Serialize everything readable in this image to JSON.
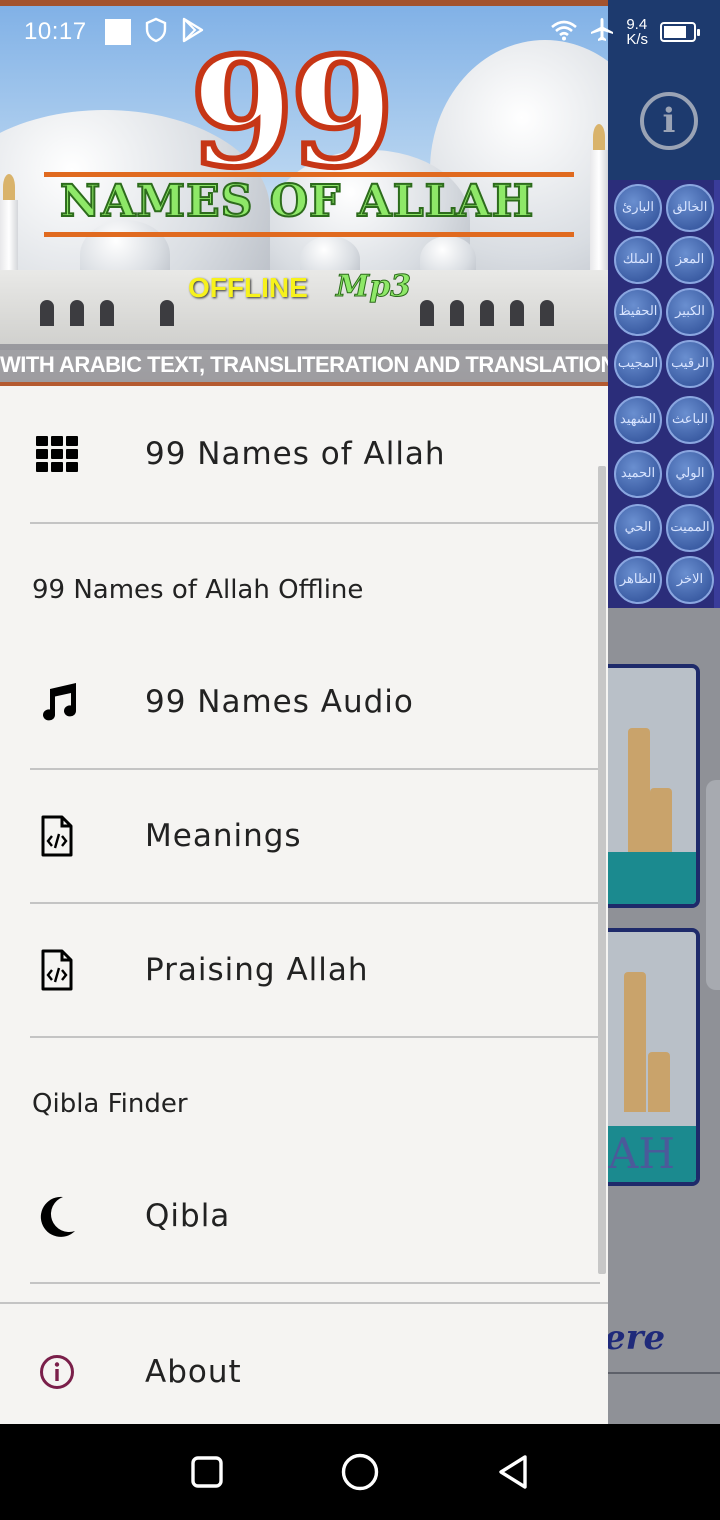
{
  "status_bar": {
    "time": "10:17",
    "net_speed_value": "9.4",
    "net_speed_unit": "K/s"
  },
  "banner": {
    "number": "99",
    "title": "NAMES OF ALLAH",
    "offline": "OFFLINE",
    "mp3": "Mp3",
    "subtitle": "WITH ARABIC TEXT, TRANSLITERATION AND TRANSLATION"
  },
  "drawer": {
    "items": [
      {
        "label": "99 Names of Allah",
        "icon": "grid-icon"
      },
      {
        "label": "99 Names Audio",
        "icon": "music-note-icon"
      },
      {
        "label": "Meanings",
        "icon": "code-file-icon"
      },
      {
        "label": "Praising Allah",
        "icon": "code-file-icon"
      },
      {
        "label": "Qibla",
        "icon": "crescent-moon-icon"
      },
      {
        "label": "About",
        "icon": "info-icon"
      }
    ],
    "sections": [
      {
        "title": "99 Names of Allah Offline"
      },
      {
        "title": "Qibla Finder"
      }
    ]
  },
  "background": {
    "card_text": "AH",
    "footer_text": "ere",
    "coins": [
      "الخالق",
      "البارئ",
      "المعز",
      "الملك",
      "الكبير",
      "الحفيظ",
      "الرقيب",
      "المجيب",
      "الباعث",
      "الشهيد",
      "الولي",
      "الحميد",
      "المميت",
      "الحي",
      "الاخر",
      "الظاهر"
    ]
  },
  "colors": {
    "drawer_bg": "#f5f4f2",
    "info_icon": "#7a1f4a",
    "bg_appbar": "#1d3a6e"
  }
}
